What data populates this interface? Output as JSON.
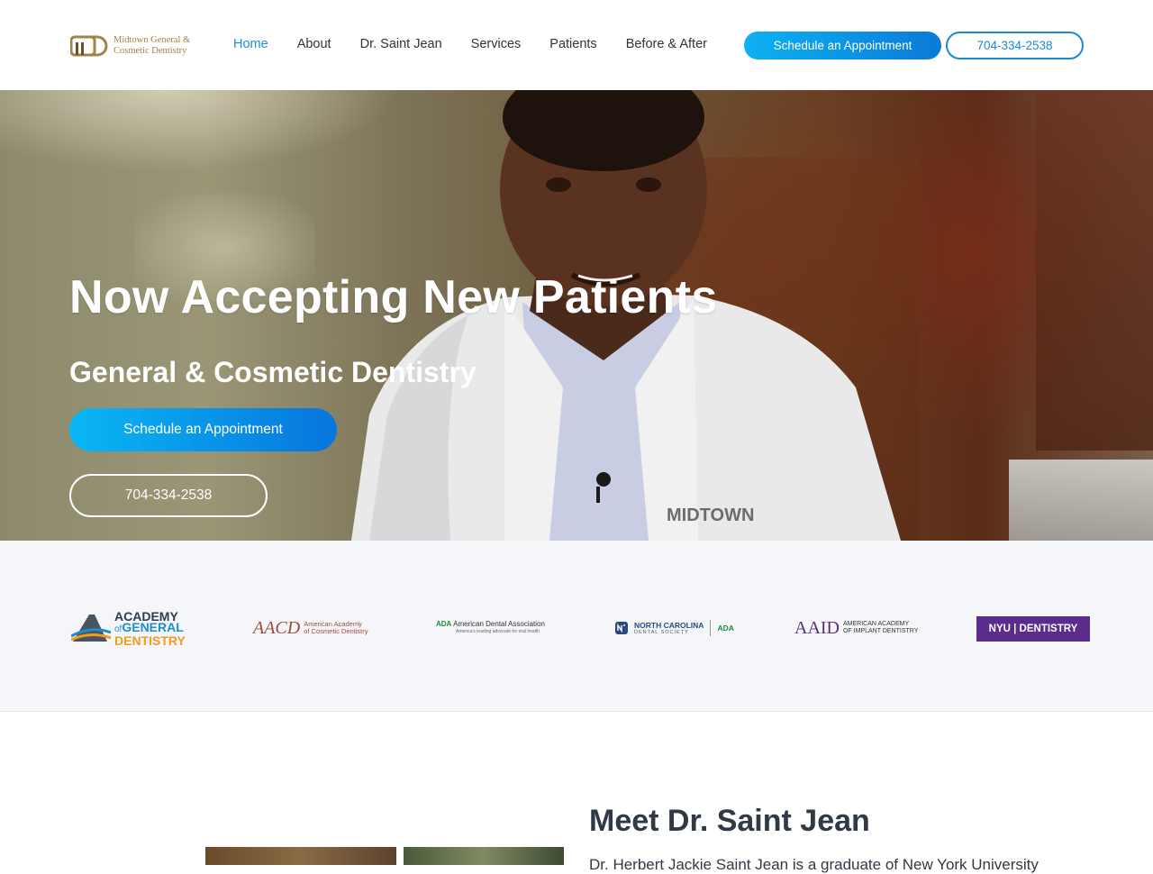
{
  "header": {
    "logo_line1": "Midtown General &",
    "logo_line2": "Cosmetic Dentistry",
    "nav": [
      {
        "label": "Home",
        "active": true
      },
      {
        "label": "About",
        "active": false
      },
      {
        "label": "Dr. Saint Jean",
        "active": false
      },
      {
        "label": "Services",
        "active": false
      },
      {
        "label": "Patients",
        "active": false
      },
      {
        "label": "Before & After",
        "active": false
      }
    ],
    "cta_label": "Schedule an Appointment",
    "phone_label": "704-334-2538"
  },
  "hero": {
    "title": "Now Accepting New Patients",
    "subtitle": "General & Cosmetic Dentistry",
    "cta_label": "Schedule an Appointment",
    "phone_label": "704-334-2538",
    "coat_text": "MIDTOWN GENERAL & COSMETIC DENTISTRY"
  },
  "affiliations": {
    "agd": {
      "line1": "ACADEMY",
      "line2_prefix": "of",
      "line2": "GENERAL",
      "line3": "DENTISTRY"
    },
    "aacd": {
      "mark": "AACD",
      "line1": "American Academy",
      "line2": "of Cosmetic Dentistry"
    },
    "ada": {
      "mark": "ADA",
      "name": "American Dental Association",
      "tagline": "America's leading advocate for oral health"
    },
    "ncds": {
      "name": "NORTH CAROLINA",
      "sub": "DENTAL SOCIETY",
      "ada": "ADA"
    },
    "aaid": {
      "mark": "AAID",
      "line1": "AMERICAN ACADEMY",
      "line2": "OF IMPLANT DENTISTRY"
    },
    "nyu": {
      "label": "NYU | DENTISTRY"
    }
  },
  "meet": {
    "title": "Meet Dr. Saint Jean",
    "text": "Dr. Herbert Jackie Saint Jean is a graduate of New York University"
  },
  "colors": {
    "accent": "#1c8fd6",
    "button_gradient_start": "#0ab6f4",
    "button_gradient_end": "#0876dc",
    "logo_gold": "#a3834a",
    "nyu_purple": "#5b2c8c"
  }
}
